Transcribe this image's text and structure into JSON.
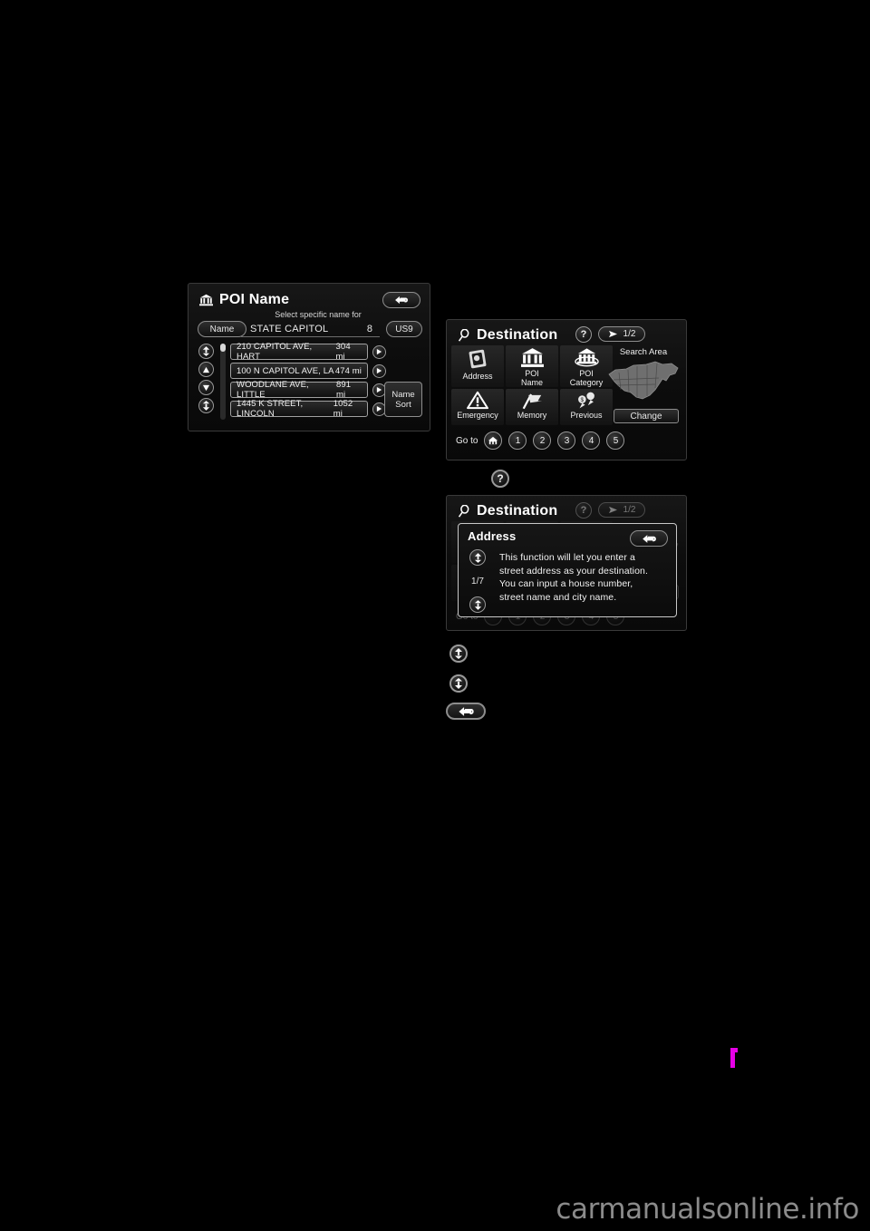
{
  "poi_name_screen": {
    "title": "POI Name",
    "title_icon": "bank-building-icon",
    "back_icon": "back-arrow-icon",
    "subtitle": "Select specific name for",
    "name_tab_label": "Name",
    "field_value": "STATE CAPITOL",
    "field_count": "8",
    "area_button_label": "US9",
    "sort_button_label_line1": "Name",
    "sort_button_label_line2": "Sort",
    "scroll_icons": [
      "scroll-to-top-icon",
      "scroll-up-icon",
      "scroll-down-icon",
      "scroll-to-bottom-icon"
    ],
    "rows": [
      {
        "name": "210 CAPITOL AVE, HART",
        "distance": "304 mi",
        "chevron": "play-arrow-icon"
      },
      {
        "name": "100 N CAPITOL AVE, LA",
        "distance": "474 mi",
        "chevron": "play-arrow-icon"
      },
      {
        "name": "WOODLANE AVE, LITTLE",
        "distance": "891 mi",
        "chevron": "play-arrow-icon"
      },
      {
        "name": "1445 K STREET, LINCOLN",
        "distance": "1052 mi",
        "chevron": "play-arrow-icon"
      }
    ]
  },
  "destination_screen": {
    "title": "Destination",
    "title_icon": "search-magnifier-icon",
    "help_label": "?",
    "page_indicator": "1/2",
    "page_arrow_icon": "next-page-arrow-icon",
    "menu_row_1": [
      {
        "label": "Address",
        "icon": "address-card-icon"
      },
      {
        "label": "POI\nName",
        "label_line1": "POI",
        "label_line2": "Name",
        "icon": "bank-building-icon"
      },
      {
        "label": "POI\nCategory",
        "label_line1": "POI",
        "label_line2": "Category",
        "icon": "bank-category-icon"
      }
    ],
    "menu_row_2": [
      {
        "label": "Emergency",
        "icon": "warning-triangle-icon"
      },
      {
        "label": "Memory",
        "icon": "flag-icon"
      },
      {
        "label": "Previous",
        "icon": "previous-destinations-icon"
      }
    ],
    "search_area_label": "Search Area",
    "search_area_map_icon": "north-america-map-icon",
    "change_button_label": "Change",
    "goto_label": "Go to",
    "goto_home_icon": "home-icon",
    "goto_presets": [
      "1",
      "2",
      "3",
      "4",
      "5"
    ]
  },
  "destination_help_screen": {
    "title": "Destination",
    "title_icon": "search-magnifier-icon",
    "help_label": "?",
    "page_indicator": "1/2",
    "goto_label": "Go to",
    "dialog": {
      "title": "Address",
      "back_icon": "back-arrow-icon",
      "scroll_up_icon": "scroll-to-top-icon",
      "scroll_down_icon": "scroll-to-bottom-icon",
      "page_index": "1/7",
      "body_line_1": "This function will let you enter a",
      "body_line_2": "street address as your destination.",
      "body_line_3": "You can input a house number,",
      "body_line_4": "street name and city name."
    }
  },
  "legend_icons": {
    "help_button": "help-question-icon",
    "scroll_up_button": "scroll-to-top-icon",
    "scroll_down_button": "scroll-to-bottom-icon",
    "back_button": "back-arrow-icon"
  },
  "page_footer": {
    "watermark": "carmanualsonline.info"
  },
  "colors": {
    "background": "#000000",
    "screen_border": "#3a3a3a",
    "text": "#ffffff",
    "accent_mark": "#e600e6",
    "watermark": "#8b8b8b"
  }
}
